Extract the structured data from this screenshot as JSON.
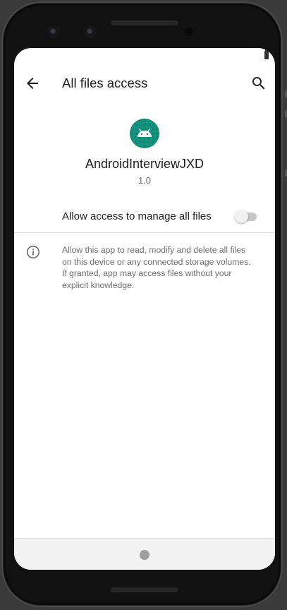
{
  "app_bar": {
    "title": "All files access",
    "back_icon": "arrow-back-icon",
    "search_icon": "search-icon"
  },
  "app_info": {
    "name": "AndroidInterviewJXD",
    "version": "1.0",
    "icon": "android-robot-icon",
    "icon_color": "#0f8a78"
  },
  "permission": {
    "toggle_label": "Allow access to manage all files",
    "toggle_state": "off"
  },
  "info": {
    "icon": "info-icon",
    "text": "Allow this app to read, modify and delete all files on this device or any connected storage volumes. If granted, app may access files without your explicit knowledge."
  },
  "navigation": {
    "home_icon": "home-dot-icon"
  },
  "colors": {
    "accent": "#0f8a78",
    "text_primary": "#202124",
    "text_secondary": "#6f6f6f"
  }
}
